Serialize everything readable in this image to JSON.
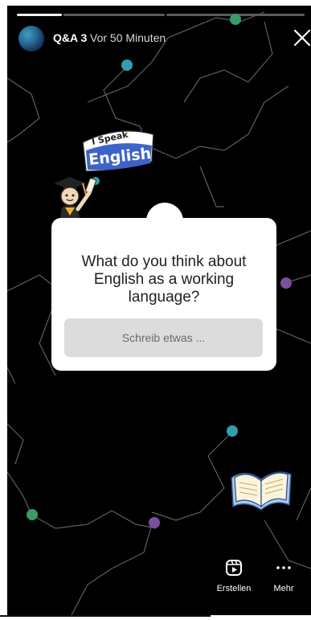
{
  "story": {
    "title": "Q&A 3",
    "time": "Vor 50 Minuten"
  },
  "question": {
    "text": "What do you think about English as a working language?",
    "placeholder": "Schreib etwas ..."
  },
  "actions": {
    "create_label": "Erstellen",
    "more_label": "Mehr"
  },
  "stickers": {
    "badge_line1": "I Speak",
    "badge_line2": "English"
  },
  "colors": {
    "background": "#000000",
    "card": "#ffffff",
    "input": "#dcdcdc",
    "dot_green": "#3a9a6a",
    "dot_teal": "#2f9fb0",
    "dot_purple": "#7a4fa0",
    "badge_blue": "#3e63c8"
  },
  "icons": {
    "close": "close-icon",
    "create": "reels-icon",
    "more": "more-icon"
  }
}
